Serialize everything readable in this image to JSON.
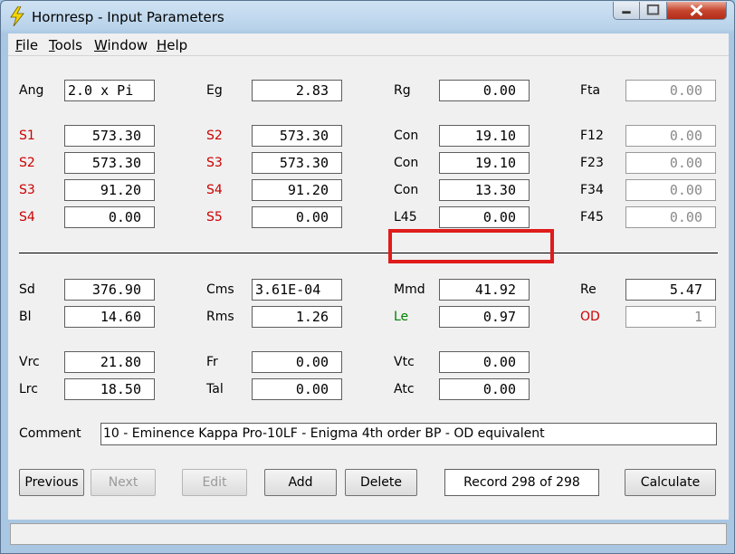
{
  "window": {
    "title": "Hornresp - Input Parameters"
  },
  "menu": [
    "File",
    "Tools",
    "Window",
    "Help"
  ],
  "rows": [
    {
      "cells": [
        {
          "label": "Ang",
          "color": "black",
          "value": "2.0 x Pi",
          "align": "left",
          "disabled": false
        },
        {
          "label": "Eg",
          "color": "black",
          "value": "2.83",
          "disabled": false
        },
        {
          "label": "Rg",
          "color": "black",
          "value": "0.00",
          "disabled": false
        },
        {
          "label": "Fta",
          "color": "black",
          "value": "0.00",
          "disabled": true
        }
      ]
    },
    {
      "cells": [
        {
          "label": "S1",
          "color": "red",
          "value": "573.30",
          "disabled": false
        },
        {
          "label": "S2",
          "color": "red",
          "value": "573.30",
          "disabled": false
        },
        {
          "label": "Con",
          "color": "black",
          "value": "19.10",
          "disabled": false
        },
        {
          "label": "F12",
          "color": "black",
          "value": "0.00",
          "disabled": true
        }
      ]
    },
    {
      "cells": [
        {
          "label": "S2",
          "color": "red",
          "value": "573.30",
          "disabled": false
        },
        {
          "label": "S3",
          "color": "red",
          "value": "573.30",
          "disabled": false
        },
        {
          "label": "Con",
          "color": "black",
          "value": "19.10",
          "disabled": false
        },
        {
          "label": "F23",
          "color": "black",
          "value": "0.00",
          "disabled": true
        }
      ]
    },
    {
      "cells": [
        {
          "label": "S3",
          "color": "red",
          "value": "91.20",
          "disabled": false
        },
        {
          "label": "S4",
          "color": "red",
          "value": "91.20",
          "disabled": false
        },
        {
          "label": "Con",
          "color": "black",
          "value": "13.30",
          "disabled": false
        },
        {
          "label": "F34",
          "color": "black",
          "value": "0.00",
          "disabled": true
        }
      ]
    },
    {
      "cells": [
        {
          "label": "S4",
          "color": "red",
          "value": "0.00",
          "disabled": false
        },
        {
          "label": "S5",
          "color": "red",
          "value": "0.00",
          "disabled": false
        },
        {
          "label": "L45",
          "color": "black",
          "value": "0.00",
          "disabled": false
        },
        {
          "label": "F45",
          "color": "black",
          "value": "0.00",
          "disabled": true
        }
      ]
    },
    {
      "cells": [
        {
          "label": "Sd",
          "color": "black",
          "value": "376.90",
          "disabled": false
        },
        {
          "label": "Cms",
          "color": "black",
          "value": "3.61E-04",
          "align": "left",
          "disabled": false
        },
        {
          "label": "Mmd",
          "color": "black",
          "value": "41.92",
          "disabled": false
        },
        {
          "label": "Re",
          "color": "black",
          "value": "5.47",
          "disabled": false
        }
      ]
    },
    {
      "cells": [
        {
          "label": "Bl",
          "color": "black",
          "value": "14.60",
          "disabled": false
        },
        {
          "label": "Rms",
          "color": "black",
          "value": "1.26",
          "disabled": false
        },
        {
          "label": "Le",
          "color": "green",
          "value": "0.97",
          "disabled": false
        },
        {
          "label": "OD",
          "color": "red",
          "value": "1",
          "disabled": true
        }
      ]
    },
    {
      "cells": [
        {
          "label": "Vrc",
          "color": "black",
          "value": "21.80",
          "disabled": false
        },
        {
          "label": "Fr",
          "color": "black",
          "value": "0.00",
          "disabled": false
        },
        {
          "label": "Vtc",
          "color": "black",
          "value": "0.00",
          "disabled": false
        }
      ]
    },
    {
      "cells": [
        {
          "label": "Lrc",
          "color": "black",
          "value": "18.50",
          "disabled": false
        },
        {
          "label": "Tal",
          "color": "black",
          "value": "0.00",
          "disabled": false
        },
        {
          "label": "Atc",
          "color": "black",
          "value": "0.00",
          "disabled": false
        }
      ]
    }
  ],
  "comment": {
    "label": "Comment",
    "value": "10 - Eminence Kappa Pro-10LF - Enigma 4th order BP - OD equivalent"
  },
  "buttons": [
    {
      "label": "Previous",
      "disabled": false
    },
    {
      "label": "Next",
      "disabled": true
    },
    {
      "label": "Edit",
      "disabled": true
    },
    {
      "label": "Add",
      "disabled": false
    },
    {
      "label": "Delete",
      "disabled": false
    }
  ],
  "record": "Record 298 of 298",
  "calculate": "Calculate",
  "colors": {
    "label_red": "#cc0000",
    "label_green": "#007f00",
    "highlight": "#e01b1b",
    "title_bar": "#b9d3ea"
  }
}
